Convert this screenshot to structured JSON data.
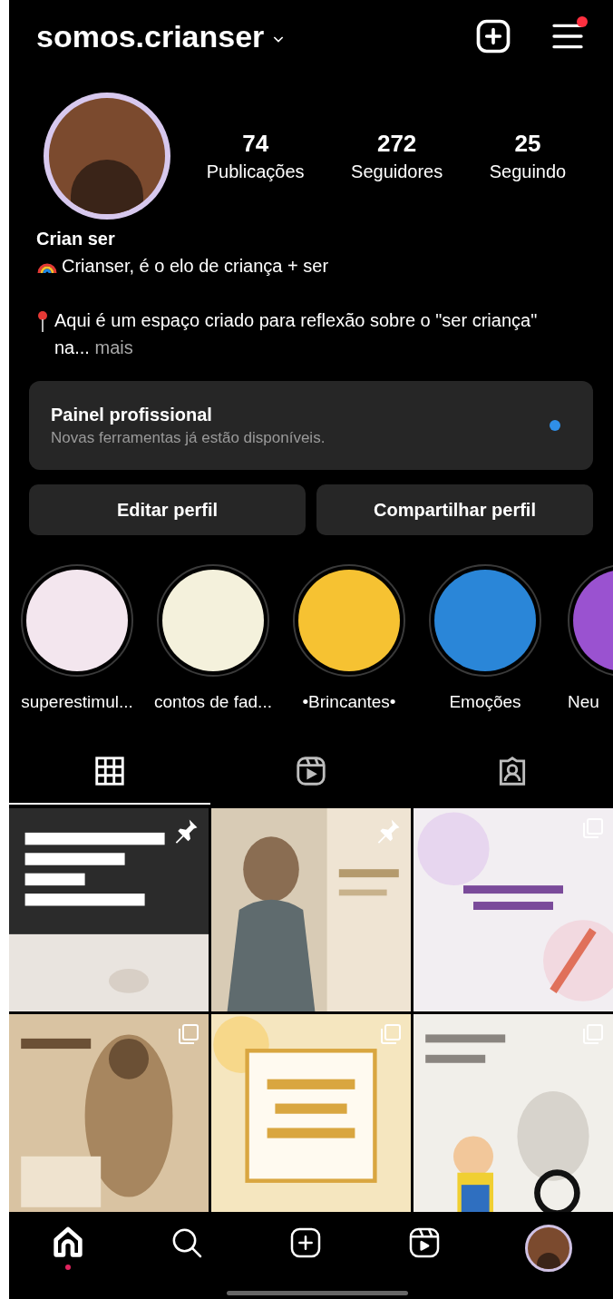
{
  "header": {
    "username": "somos.crianser",
    "menu_notification": true
  },
  "profile": {
    "stats": [
      {
        "value": "74",
        "label": "Publicações"
      },
      {
        "value": "272",
        "label": "Seguidores"
      },
      {
        "value": "25",
        "label": "Seguindo"
      }
    ],
    "name": "Crian ser",
    "bio_line": "Crianser, é o elo de criança + ser",
    "bio_more": "Aqui é um espaço criado para reflexão sobre o \"ser criança\" na...",
    "more_link": "mais"
  },
  "dashboard": {
    "title": "Painel profissional",
    "subtitle": "Novas ferramentas já estão disponíveis.",
    "unread": true
  },
  "buttons": [
    "Editar perfil",
    "Compartilhar perfil"
  ],
  "highlights": [
    {
      "label": "superestimul...",
      "color": "#f3e6ee"
    },
    {
      "label": "contos de fad...",
      "color": "#f4f1dc"
    },
    {
      "label": "•Brincantes•",
      "color": "#f6c232"
    },
    {
      "label": "Emoções",
      "color": "#2a86d8"
    },
    {
      "label": "Neu",
      "color": "#9a52d0"
    }
  ],
  "tabs": [
    {
      "kind": "grid",
      "selected": true
    },
    {
      "kind": "reels",
      "selected": false
    },
    {
      "kind": "tagged",
      "selected": false
    }
  ],
  "posts": [
    {
      "kind": "picture",
      "pinned": true,
      "carousel": false
    },
    {
      "kind": "picture",
      "pinned": true,
      "carousel": false
    },
    {
      "kind": "picture",
      "pinned": false,
      "carousel": true
    },
    {
      "kind": "picture",
      "pinned": false,
      "carousel": true
    },
    {
      "kind": "picture",
      "pinned": false,
      "carousel": true
    },
    {
      "kind": "picture",
      "pinned": false,
      "carousel": true
    }
  ],
  "bottom_nav": [
    {
      "kind": "home",
      "selected": true
    },
    {
      "kind": "search",
      "selected": false
    },
    {
      "kind": "create",
      "selected": false
    },
    {
      "kind": "reels",
      "selected": false
    },
    {
      "kind": "profile",
      "selected": false
    }
  ]
}
